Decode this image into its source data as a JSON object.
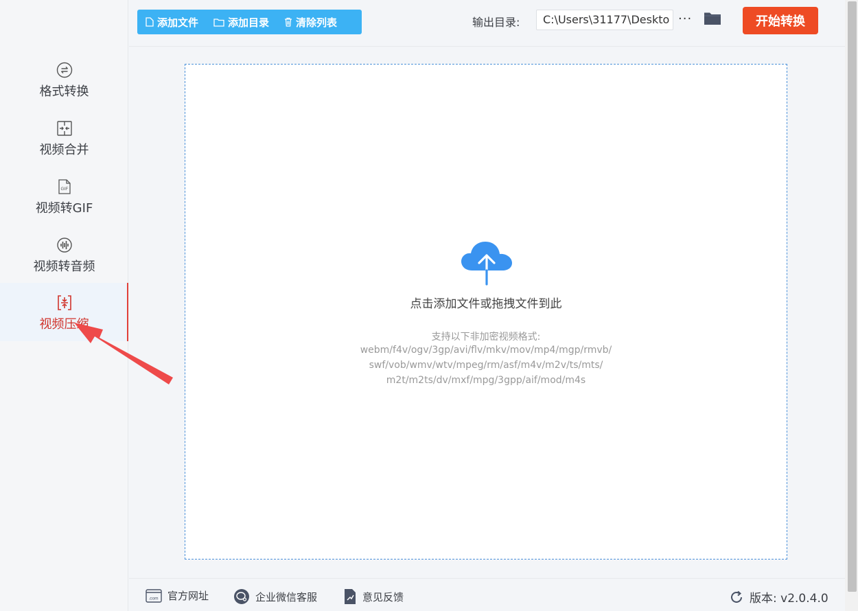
{
  "sidebar": {
    "items": [
      {
        "label": "格式转换",
        "icon": "convert-icon"
      },
      {
        "label": "视频合并",
        "icon": "merge-icon"
      },
      {
        "label": "视频转GIF",
        "icon": "gif-icon"
      },
      {
        "label": "视频转音频",
        "icon": "audio-icon"
      },
      {
        "label": "视频压缩",
        "icon": "compress-icon",
        "active": true
      }
    ]
  },
  "toolbar": {
    "add_file": "添加文件",
    "add_dir": "添加目录",
    "clear_list": "清除列表",
    "output_label": "输出目录:",
    "output_path": "C:\\Users\\31177\\Deskto",
    "more": "···",
    "start": "开始转换"
  },
  "dropzone": {
    "title": "点击添加文件或拖拽文件到此",
    "subtitle": "支持以下非加密视频格式:",
    "formats": [
      "webm/f4v/ogv/3gp/avi/flv/mkv/mov/mp4/mgp/rmvb/",
      "swf/vob/wmv/wtv/mpeg/rm/asf/m4v/m2v/ts/mts/",
      "m2t/m2ts/dv/mxf/mpg/3gpp/aif/mod/m4s"
    ]
  },
  "footer": {
    "website": "官方网址",
    "wechat": "企业微信客服",
    "feedback": "意见反馈",
    "version": "版本: v2.0.4.0",
    "website_icon_text": ".com"
  },
  "colors": {
    "accent_blue": "#3cb2f4",
    "start_red": "#ee4b24",
    "active_red": "#d0342c",
    "cloud_blue": "#3a93f0",
    "arrow_red": "#ee4a4a"
  }
}
